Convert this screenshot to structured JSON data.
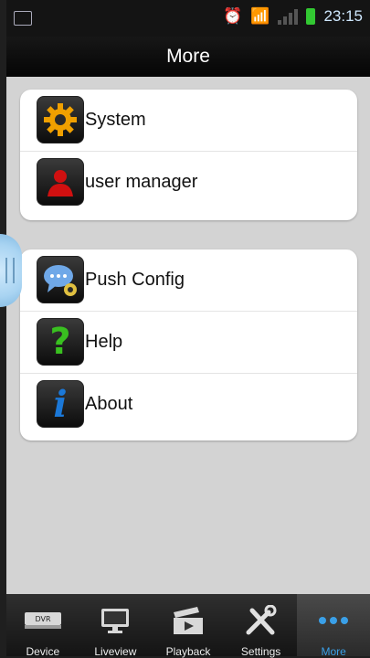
{
  "status_bar": {
    "time": "23:15"
  },
  "header": {
    "title": "More"
  },
  "groups": [
    {
      "items": [
        {
          "label": "System",
          "icon": "gear-icon"
        },
        {
          "label": "user manager",
          "icon": "user-icon"
        }
      ]
    },
    {
      "items": [
        {
          "label": "Push Config",
          "icon": "push-config-icon"
        },
        {
          "label": "Help",
          "icon": "help-icon"
        },
        {
          "label": "About",
          "icon": "info-icon"
        }
      ]
    }
  ],
  "tab_bar": {
    "active": "More",
    "tabs": [
      {
        "label": "Device",
        "icon": "dvr-icon",
        "dvr_text": "DVR"
      },
      {
        "label": "Liveview",
        "icon": "monitor-icon"
      },
      {
        "label": "Playback",
        "icon": "playback-icon"
      },
      {
        "label": "Settings",
        "icon": "tools-icon"
      },
      {
        "label": "More",
        "icon": "more-dots-icon"
      }
    ]
  },
  "colors": {
    "accent": "#3aa0e8",
    "content_bg": "#d3d3d3",
    "gear": "#f0a000",
    "user": "#d01010",
    "help": "#39c020",
    "about": "#1b78d8",
    "battery": "#32c832"
  }
}
